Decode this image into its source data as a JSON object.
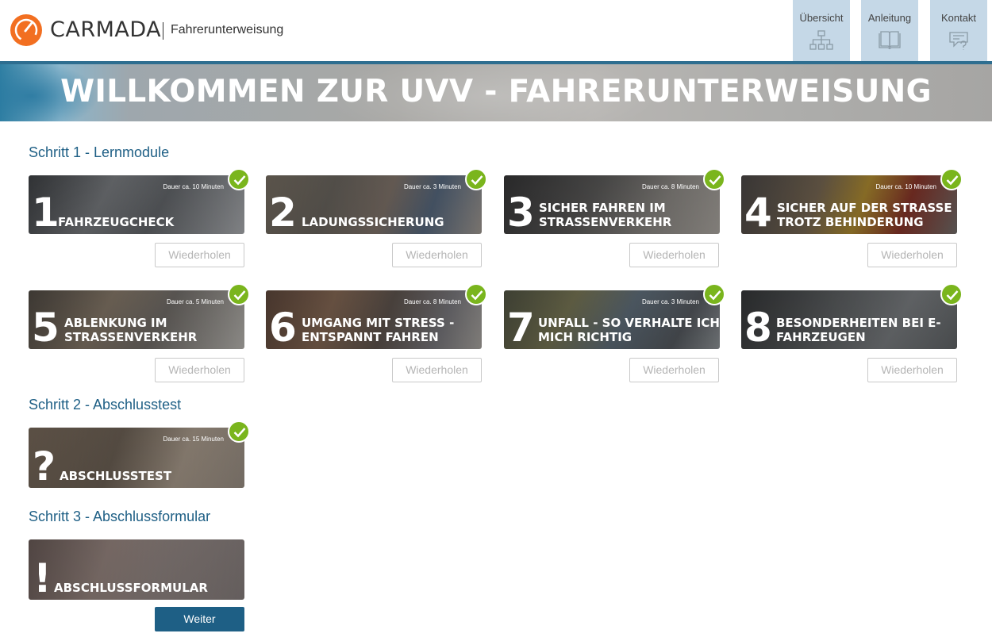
{
  "header": {
    "brand": "CARMADA",
    "subtitle": "Fahrerunterweisung",
    "nav": [
      {
        "label": "Übersicht",
        "icon": "sitemap-icon"
      },
      {
        "label": "Anleitung",
        "icon": "book-icon"
      },
      {
        "label": "Kontakt",
        "icon": "chat-question-icon"
      }
    ]
  },
  "banner": {
    "title": "WILLKOMMEN ZUR UVV - FAHRERUNTERWEISUNG"
  },
  "colors": {
    "accent": "#1e5f85",
    "nav_bg": "#c5d8e7",
    "check": "#7ab51d",
    "logo": "#f26f21"
  },
  "steps": [
    {
      "title": "Schritt 1 - Lernmodule",
      "modules": [
        {
          "number": "1",
          "title_line1": "FAHRZEUGCHECK",
          "title_line2": "",
          "duration": "Dauer ca. 10 Minuten",
          "completed": true,
          "button": "Wiederholen"
        },
        {
          "number": "2",
          "title_line1": "LADUNGSSICHERUNG",
          "title_line2": "",
          "duration": "Dauer ca. 3 Minuten",
          "completed": true,
          "button": "Wiederholen"
        },
        {
          "number": "3",
          "title_line1": "SICHER FAHREN IM",
          "title_line2": "STRASSENVERKEHR",
          "duration": "Dauer ca. 8 Minuten",
          "completed": true,
          "button": "Wiederholen"
        },
        {
          "number": "4",
          "title_line1": "SICHER AUF DER STRASSE",
          "title_line2": "TROTZ BEHINDERUNG",
          "duration": "Dauer ca. 10 Minuten",
          "completed": true,
          "button": "Wiederholen"
        },
        {
          "number": "5",
          "title_line1": "ABLENKUNG IM",
          "title_line2": "STRASSENVERKEHR",
          "duration": "Dauer ca. 5 Minuten",
          "completed": true,
          "button": "Wiederholen"
        },
        {
          "number": "6",
          "title_line1": "UMGANG MIT STRESS -",
          "title_line2": "ENTSPANNT FAHREN",
          "duration": "Dauer ca. 8 Minuten",
          "completed": true,
          "button": "Wiederholen"
        },
        {
          "number": "7",
          "title_line1": "UNFALL - SO VERHALTE ICH",
          "title_line2": "MICH RICHTIG",
          "duration": "Dauer ca. 3 Minuten",
          "completed": true,
          "button": "Wiederholen"
        },
        {
          "number": "8",
          "title_line1": "BESONDERHEITEN BEI E-",
          "title_line2": "FAHRZEUGEN",
          "duration": "",
          "completed": true,
          "button": "Wiederholen"
        }
      ]
    },
    {
      "title": "Schritt 2 - Abschlusstest",
      "card": {
        "symbol": "?",
        "title": "ABSCHLUSSTEST",
        "duration": "Dauer ca. 15 Minuten",
        "completed": true
      }
    },
    {
      "title": "Schritt 3 - Abschlussformular",
      "card": {
        "symbol": "!",
        "title": "ABSCHLUSSFORMULAR",
        "duration": "",
        "completed": false
      },
      "button": "Weiter"
    }
  ]
}
